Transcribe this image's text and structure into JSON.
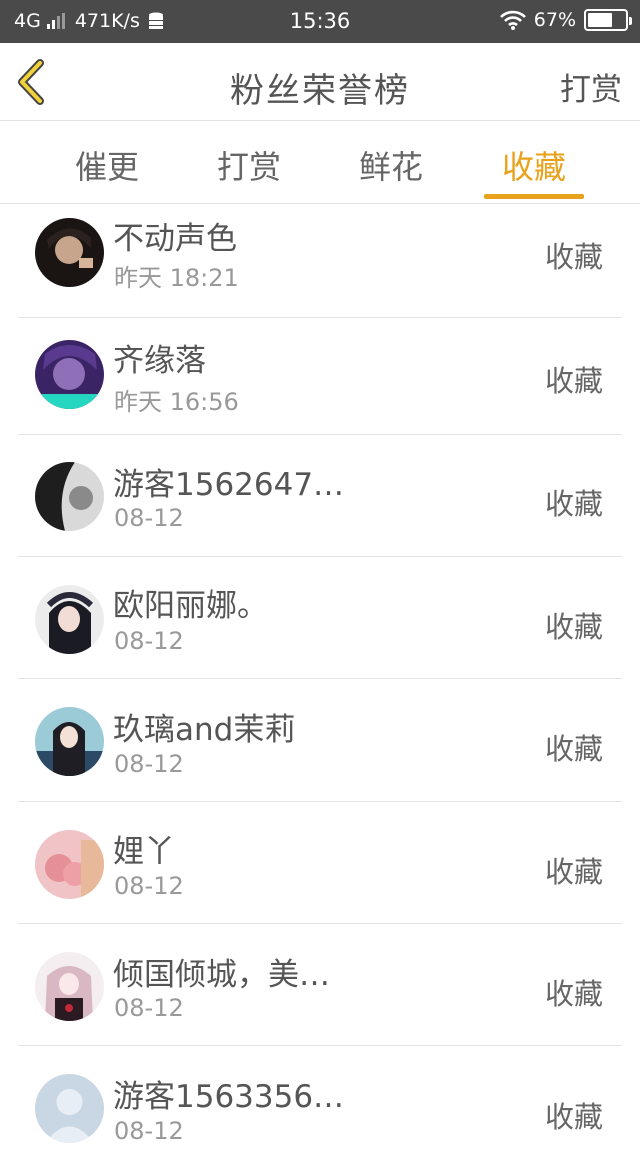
{
  "status_bar": {
    "network": "4G",
    "speed": "471K/s",
    "time": "15:36",
    "battery": "67%",
    "battery_level": 0.67
  },
  "header": {
    "title": "粉丝荣誉榜",
    "right_action": "打赏"
  },
  "tabs": [
    {
      "label": "催更",
      "active": false
    },
    {
      "label": "打赏",
      "active": false
    },
    {
      "label": "鲜花",
      "active": false
    },
    {
      "label": "收藏",
      "active": true
    }
  ],
  "items": [
    {
      "name": "不动声色",
      "time": "昨天 18:21",
      "action": "收藏"
    },
    {
      "name": "齐缘落",
      "time": "昨天 16:56",
      "action": "收藏"
    },
    {
      "name": "游客1562647…",
      "time": "08-12",
      "action": "收藏"
    },
    {
      "name": "欧阳丽娜。",
      "time": "08-12",
      "action": "收藏"
    },
    {
      "name": "玖璃and茉莉",
      "time": "08-12",
      "action": "收藏"
    },
    {
      "name": "娌丫",
      "time": "08-12",
      "action": "收藏"
    },
    {
      "name": "倾国倾城，美…",
      "time": "08-12",
      "action": "收藏"
    },
    {
      "name": "游客1563356…",
      "time": "08-12",
      "action": "收藏"
    }
  ],
  "colors": {
    "accent": "#e9a21b",
    "status_bar_bg": "#4a4a4a",
    "text": "#555555",
    "subtext": "#999999"
  }
}
